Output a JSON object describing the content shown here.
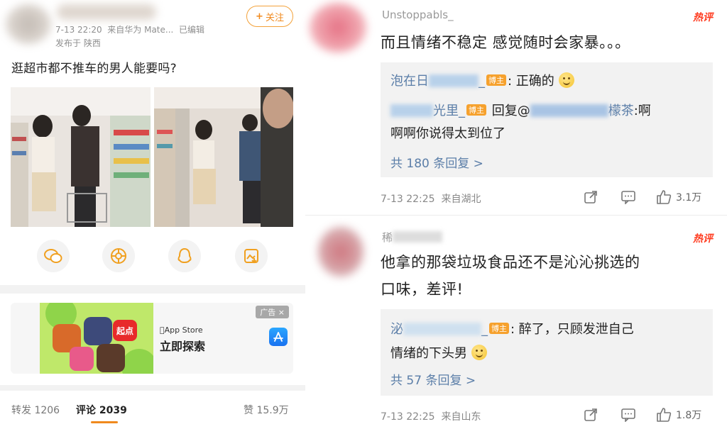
{
  "post": {
    "timestamp": "7-13 22:20",
    "source": "来自华为 Mate...",
    "edited": "已编辑",
    "location": "发布于 陕西",
    "follow_label": "关注",
    "text": "逛超市都不推车的男人能要吗?"
  },
  "share_icons": [
    "wechat-icon",
    "moments-icon",
    "qq-icon",
    "save-image-icon"
  ],
  "ad": {
    "badge": "广告 ×",
    "store": "App Store",
    "cta": "立即探索",
    "tile_text": "起点"
  },
  "tabs": {
    "repost": "转发 1206",
    "comments": "评论 2039",
    "likes": "赞 15.9万"
  },
  "comments": [
    {
      "username": "Unstoppabls_",
      "hot_tag": "热评",
      "text": "而且情绪不稳定 感觉随时会家暴。。。",
      "replies": [
        {
          "name": "泡在日",
          "suffix": "_",
          "badge": "博主",
          "text": ": 正确的"
        },
        {
          "name": "",
          "suffix": "光里_",
          "badge": "博主",
          "text": " 回复@",
          "mention_tail": "檬茶",
          "text2": ":啊",
          "line2": "啊啊你说得太到位了"
        }
      ],
      "more": "共 180 条回复 >",
      "date": "7-13 22:25",
      "origin": "来自湖北",
      "likes": "3.1万"
    },
    {
      "username": "稀",
      "hot_tag": "热评",
      "text_line1": "他拿的那袋垃圾食品还不是沁沁挑选的",
      "text_line2": "口味，差评!",
      "replies": [
        {
          "name": "泌",
          "suffix": "_",
          "badge": "博主",
          "text": ": 醉了，只顾发泄自己",
          "line2": "情绪的下头男"
        }
      ],
      "more": "共 57 条回复 >",
      "date": "7-13 22:25",
      "origin": "来自山东",
      "likes": "1.8万"
    }
  ],
  "colors": {
    "accent_orange": "#f08a1e",
    "hot_red": "#ff3b1f",
    "link_blue": "#5b7ea8",
    "reply_bg": "#f2f2f2"
  }
}
